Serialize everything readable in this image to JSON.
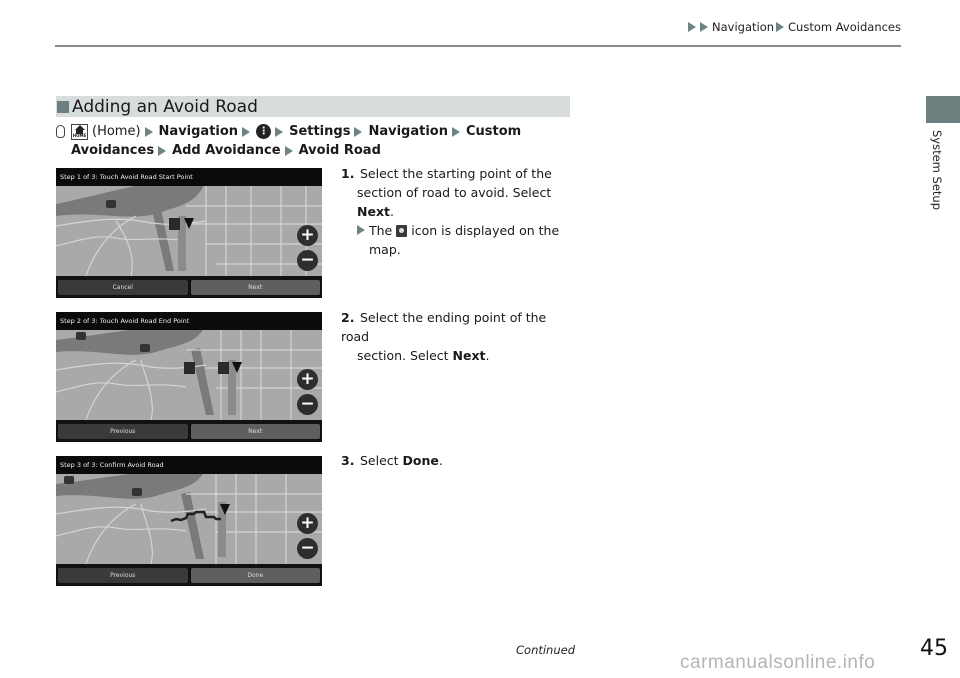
{
  "header": {
    "breadcrumb": [
      "Navigation",
      "Custom Avoidances"
    ]
  },
  "side_tab": {
    "label": "System Setup",
    "color": "#6e7f7f"
  },
  "section": {
    "title": "Adding an Avoid Road",
    "accent": "#6e7f7f"
  },
  "nav_path": {
    "voice_icon": "microphone-icon",
    "home_icon": "home-icon",
    "home_label": "(Home)",
    "more_icon": "more-vertical-icon",
    "steps": [
      "Navigation",
      "Settings",
      "Navigation",
      "Custom Avoidances",
      "Add Avoidance",
      "Avoid Road"
    ],
    "line1": {
      "navigation": "Navigation",
      "settings": "Settings",
      "navigation2": "Navigation",
      "custom": "Custom"
    },
    "line2": {
      "avoidances": "Avoidances",
      "add": "Add Avoidance",
      "avoid": "Avoid Road"
    }
  },
  "screens": [
    {
      "title": "Step 1 of 3: Touch Avoid Road Start Point",
      "buttons": [
        "Cancel",
        "Next"
      ]
    },
    {
      "title": "Step 2 of 3: Touch Avoid Road End Point",
      "buttons": [
        "Previous",
        "Next"
      ]
    },
    {
      "title": "Step 3 of 3: Confirm Avoid Road",
      "buttons": [
        "Previous",
        "Done"
      ]
    }
  ],
  "steps": [
    {
      "number": "1.",
      "text_a": "Select the starting point of the",
      "text_b": "section of road to avoid. Select",
      "bold": "Next",
      "after_bold": ".",
      "sub_before": "The",
      "sub_after": "icon is displayed on the",
      "sub_after2": "map."
    },
    {
      "number": "2.",
      "text_a": "Select the ending point of the road",
      "text_b_before": "section. Select",
      "bold": "Next",
      "after_bold": "."
    },
    {
      "number": "3.",
      "text_before": "Select",
      "bold": "Done",
      "after_bold": "."
    }
  ],
  "footer": {
    "continued": "Continued",
    "page_number": "45",
    "watermark": "carmanualsonline.info"
  }
}
